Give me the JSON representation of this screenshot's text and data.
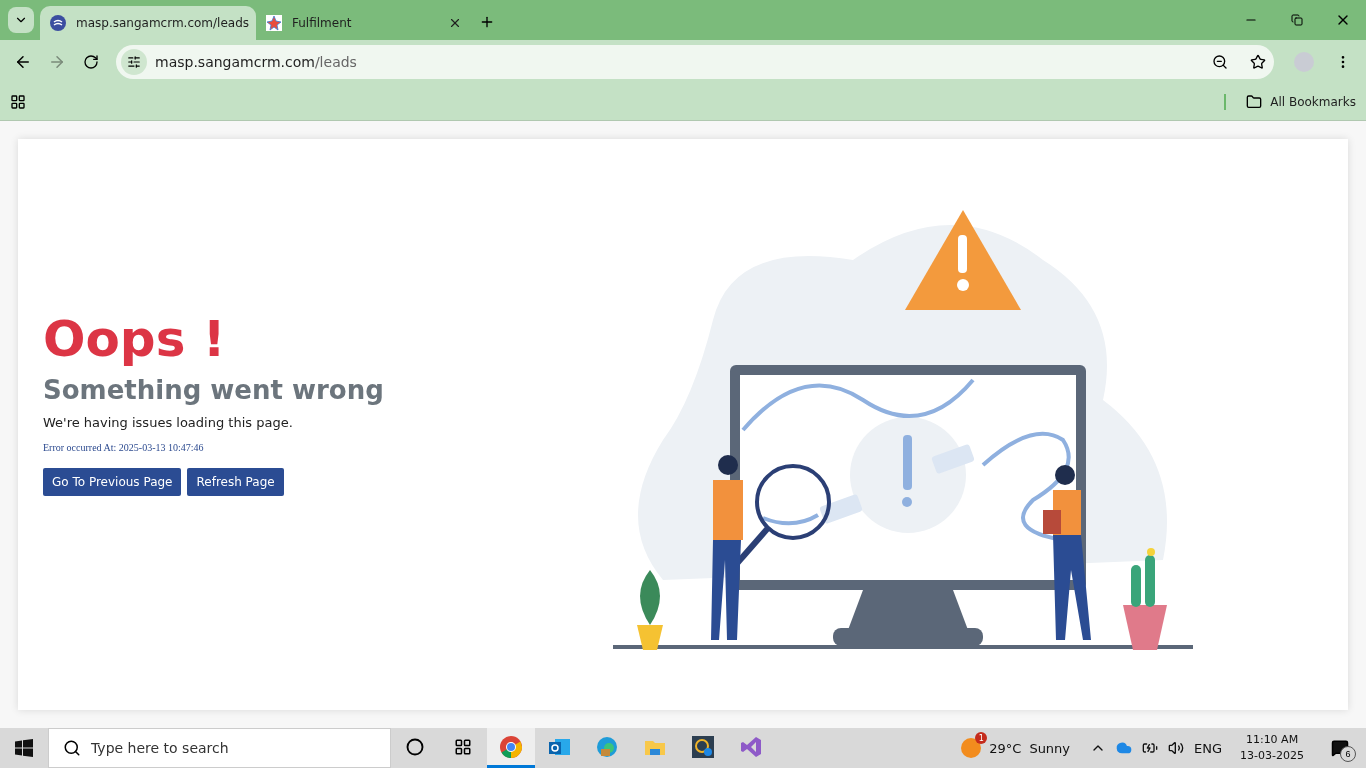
{
  "browser": {
    "tabs": [
      {
        "title": "masp.sangamcrm.com/leads",
        "kind": "crm",
        "selected": true
      },
      {
        "title": "Fulfilment",
        "kind": "star",
        "selected": false
      }
    ],
    "address": {
      "host": "masp.sangamcrm.com",
      "path": "/leads"
    },
    "bookmarks": {
      "label": "All Bookmarks"
    }
  },
  "error_page": {
    "title": "Oops !",
    "heading": "Something went wrong",
    "message": "We're having issues loading this page.",
    "timestamp": "Error occurred At: 2025-03-13 10:47:46",
    "buttons": [
      "Go To Previous Page",
      "Refresh Page"
    ]
  },
  "taskbar": {
    "search": {
      "placeholder": "Type here to search"
    },
    "apps": [
      {
        "kind": "chrome",
        "selected": true
      },
      {
        "kind": "outlook",
        "selected": false
      },
      {
        "kind": "edge",
        "selected": false
      },
      {
        "kind": "files",
        "selected": false
      },
      {
        "kind": "check",
        "selected": false
      },
      {
        "kind": "studio",
        "selected": false
      }
    ],
    "weather": {
      "badge": "1",
      "temperature": "29°C",
      "condition": "Sunny"
    },
    "language": "ENG",
    "time": "11:10 AM",
    "date": "13-03-2025",
    "notifications": "6"
  }
}
